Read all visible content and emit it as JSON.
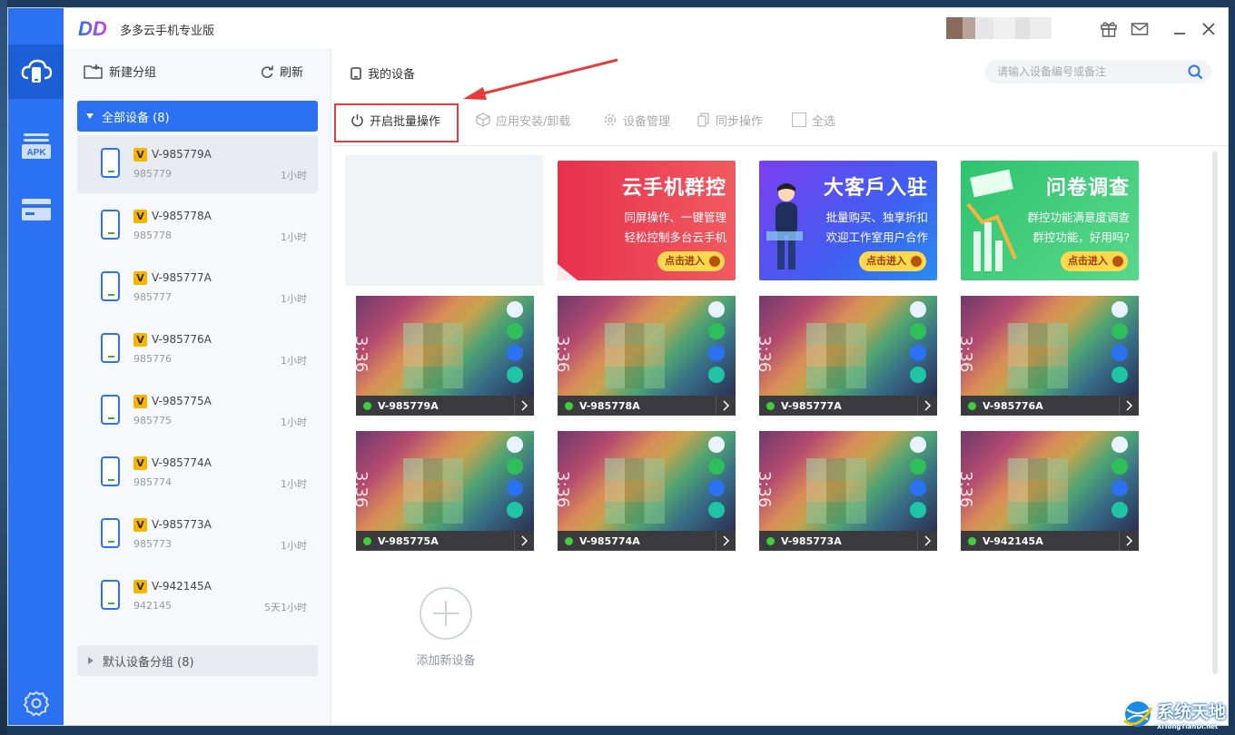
{
  "desktop": {
    "taskbar_text": ""
  },
  "app": {
    "title": "多多云手机专业版",
    "logo_text": "DD"
  },
  "rail": {
    "apk_label": "APK"
  },
  "sidebar": {
    "new_group": "新建分组",
    "refresh": "刷新",
    "group_all": "全部设备 (8)",
    "group_default": "默认设备分组 (8)",
    "devices": [
      {
        "badge": "V",
        "name": "V-985779A",
        "id": "985779",
        "time": "1小时"
      },
      {
        "badge": "V",
        "name": "V-985778A",
        "id": "985778",
        "time": "1小时"
      },
      {
        "badge": "V",
        "name": "V-985777A",
        "id": "985777",
        "time": "1小时"
      },
      {
        "badge": "V",
        "name": "V-985776A",
        "id": "985776",
        "time": "1小时"
      },
      {
        "badge": "V",
        "name": "V-985775A",
        "id": "985775",
        "time": "1小时"
      },
      {
        "badge": "V",
        "name": "V-985774A",
        "id": "985774",
        "time": "1小时"
      },
      {
        "badge": "V",
        "name": "V-985773A",
        "id": "985773",
        "time": "1小时"
      },
      {
        "badge": "V",
        "name": "V-942145A",
        "id": "942145",
        "time": "5天1小时"
      }
    ]
  },
  "main": {
    "breadcrumb": "我的设备",
    "search_placeholder": "请输入设备编号或备注",
    "toolbar": {
      "batch": "开启批量操作",
      "install": "应用安装/卸载",
      "manage": "设备管理",
      "sync": "同步操作",
      "select_all": "全选"
    },
    "banners": [
      {
        "title": "云手机群控",
        "line1": "同屏操作、一键管理",
        "line2": "轻松控制多台云手机",
        "button": "点击进入"
      },
      {
        "title": "大客戶入驻",
        "line1": "批量购买、独享折扣",
        "line2": "欢迎工作室用户合作",
        "button": "点击进入"
      },
      {
        "title": "问卷调查",
        "line1": "群控功能满意度调查",
        "line2": "群控功能，好用吗?",
        "button": "点击进入"
      }
    ],
    "screen_time": "3:36",
    "cards": [
      "V-985779A",
      "V-985778A",
      "V-985777A",
      "V-985776A",
      "V-985775A",
      "V-985774A",
      "V-985773A",
      "V-942145A"
    ],
    "add_device": "添加新设备"
  },
  "watermark": {
    "title": "系统天地",
    "subtitle": "XiTongTianDi.net"
  },
  "colors": {
    "accent": "#2b72f2",
    "highlight": "#e53c3c",
    "online": "#3ed03a",
    "badge": "#f6b500"
  }
}
